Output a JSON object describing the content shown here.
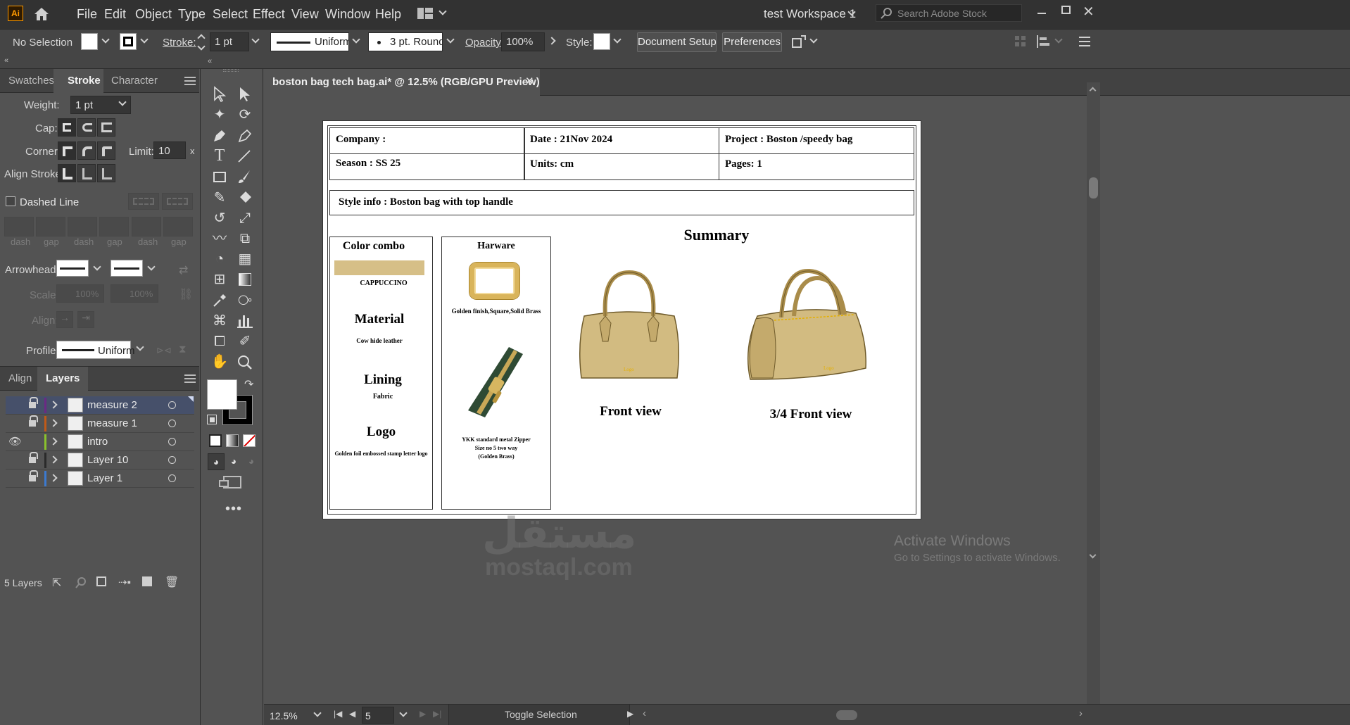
{
  "app": {
    "logo": "Ai",
    "workspace": "test Workspace 1",
    "search_placeholder": "Search Adobe Stock"
  },
  "menu": [
    "File",
    "Edit",
    "Object",
    "Type",
    "Select",
    "Effect",
    "View",
    "Window",
    "Help"
  ],
  "control_bar": {
    "selection": "No Selection",
    "stroke_label": "Stroke:",
    "stroke_weight": "1 pt",
    "profile": "Uniform",
    "brush": "3 pt. Round",
    "opacity_label": "Opacity:",
    "opacity_value": "100%",
    "style_label": "Style:",
    "document_setup": "Document Setup",
    "preferences": "Preferences"
  },
  "stroke_panel": {
    "tabs": [
      "Swatches",
      "Stroke",
      "Character"
    ],
    "weight_label": "Weight:",
    "weight_value": "1 pt",
    "cap_label": "Cap:",
    "corner_label": "Corner:",
    "limit_label": "Limit:",
    "limit_value": "10",
    "limit_unit": "x",
    "align_label": "Align Stroke:",
    "dashed_line": "Dashed Line",
    "dash_labels": [
      "dash",
      "gap",
      "dash",
      "gap",
      "dash",
      "gap"
    ],
    "arrowheads_label": "Arrowheads:",
    "scale_label": "Scale:",
    "scale_1": "100%",
    "scale_2": "100%",
    "align2_label": "Align:",
    "profile_label": "Profile:",
    "profile_value": "Uniform"
  },
  "layers_panel": {
    "tabs": [
      "Align",
      "Layers"
    ],
    "layers": [
      {
        "name": "measure 2",
        "locked": true,
        "visible": false,
        "color": "#6a2a84",
        "selected": true
      },
      {
        "name": "measure 1",
        "locked": true,
        "visible": false,
        "color": "#c05a18",
        "selected": false
      },
      {
        "name": "intro",
        "locked": false,
        "visible": true,
        "color": "#8ac22c",
        "selected": false
      },
      {
        "name": "Layer 10",
        "locked": true,
        "visible": false,
        "color": "#2a2a2a",
        "selected": false
      },
      {
        "name": "Layer 1",
        "locked": true,
        "visible": false,
        "color": "#3c7ad0",
        "selected": false
      }
    ],
    "count": "5 Layers"
  },
  "document": {
    "tab_title": "boston bag tech bag.ai* @ 12.5% (RGB/GPU Preview)"
  },
  "techpack": {
    "company": "Company :",
    "date": "Date : 21Nov 2024",
    "project": "Project : Boston /speedy bag",
    "season": "Season : SS 25",
    "units": "Units: cm",
    "pages": "Pages: 1",
    "style_info": "Style info : Boston bag with top handle",
    "color_combo": "Color combo",
    "color_name": "CAPPUCCINO",
    "color_swatch": "#d6bf87",
    "material_title": "Material",
    "material_value": "Cow hide leather",
    "lining_title": "Lining",
    "lining_value": "Fabric",
    "logo_title": "Logo",
    "logo_value": "Golden foil embossed stamp letter logo",
    "hardware_title": "Harware",
    "hardware_1": "Golden finish,Square,Solid Brass",
    "hardware_2_l1": "YKK standard metal Zipper",
    "hardware_2_l2": "Size no 5 two way",
    "hardware_2_l3": "(Golden Brass)",
    "summary": "Summary",
    "front_view": "Front view",
    "three_quarter_view": "3/4 Front view",
    "bag_color": "#d2bb81"
  },
  "status": {
    "zoom": "12.5%",
    "artboard": "5",
    "toggle": "Toggle Selection"
  },
  "watermark": {
    "arabic": "مستقل",
    "latin": "mostaql.com"
  },
  "windows_notice": {
    "title": "Activate Windows",
    "sub": "Go to Settings to activate Windows."
  }
}
